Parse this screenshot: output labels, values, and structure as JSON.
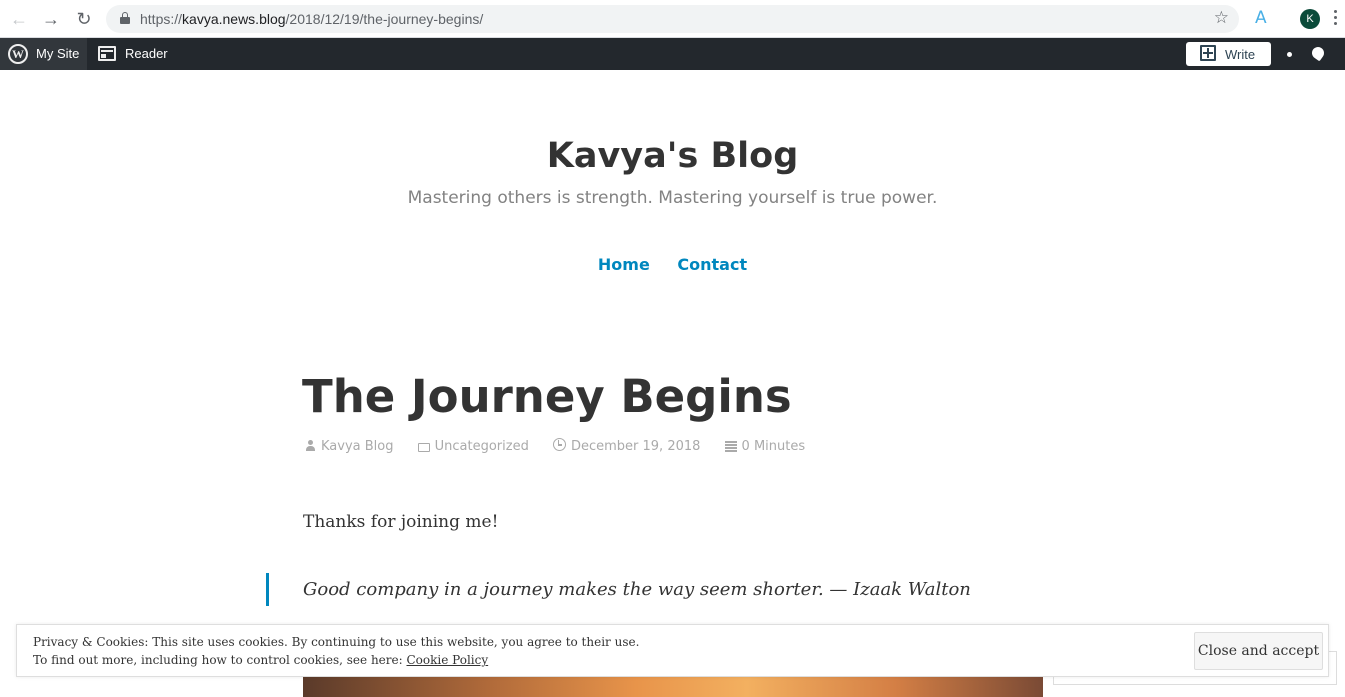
{
  "browser": {
    "url_prefix": "https://",
    "url_host": "kavya.news.blog",
    "url_path": "/2018/12/19/the-journey-begins/",
    "profile_initial": "K",
    "extension_label": "A"
  },
  "adminbar": {
    "my_site_label": "My Site",
    "reader_label": "Reader",
    "write_label": "Write",
    "wp_logo_glyph": "W"
  },
  "site": {
    "title": "Kavya's Blog",
    "description": "Mastering others is strength. Mastering yourself is true power.",
    "nav": [
      "Home",
      "Contact"
    ]
  },
  "post": {
    "title": "The Journey Begins",
    "meta": {
      "author": "Kavya Blog",
      "category": "Uncategorized",
      "date": "December 19, 2018",
      "reading_time": "0 Minutes"
    },
    "paragraph": "Thanks for joining me!",
    "quote": "Good company in a journey makes the way seem shorter. — Izaak Walton"
  },
  "cookie": {
    "line1": "Privacy & Cookies: This site uses cookies. By continuing to use this website, you agree to their use.",
    "line2_prefix": "To find out more, including how to control cookies, see here: ",
    "policy_link": "Cookie Policy",
    "button": "Close and accept"
  },
  "colors": {
    "accent": "#0087be",
    "adminbar": "#23282d",
    "text": "#333333",
    "meta": "#aaaaaa"
  }
}
